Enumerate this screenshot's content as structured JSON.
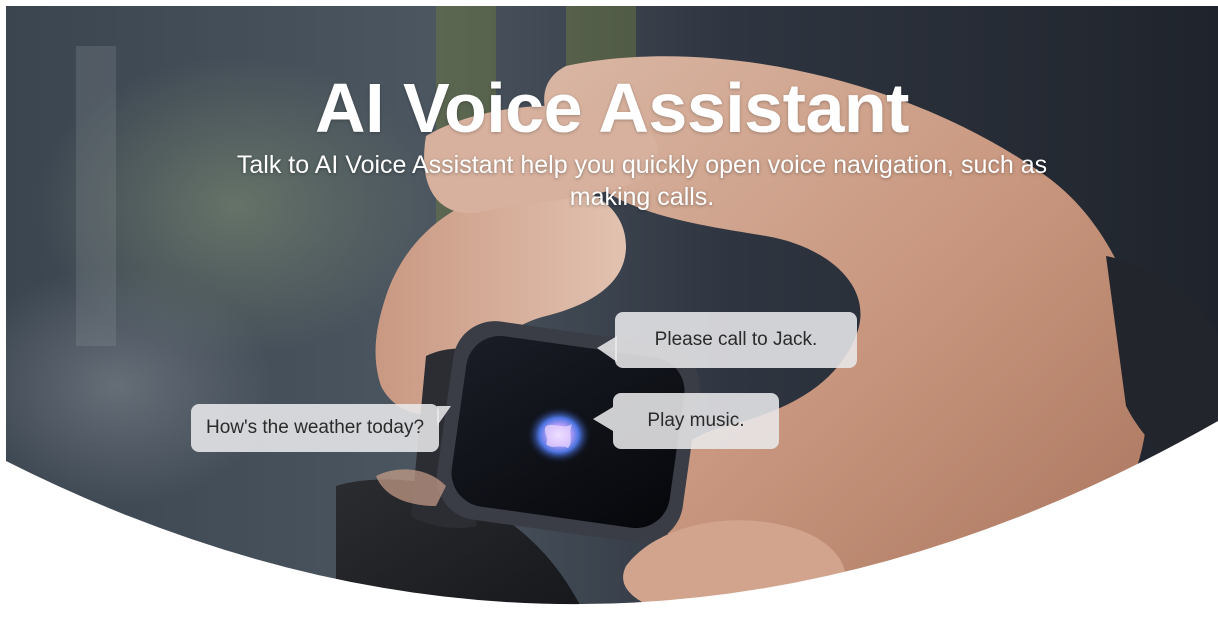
{
  "hero": {
    "title": "AI Voice Assistant",
    "subtitle": "Talk to AI Voice Assistant help you quickly open voice navigation, such as making calls."
  },
  "bubbles": {
    "call": "Please call to Jack.",
    "music": "Play music.",
    "weather": "How's the weather today?"
  },
  "colors": {
    "background": "#ffffff",
    "bubble": "#e8e8ea",
    "text": "#ffffff",
    "bubble_text": "#2b2b2b"
  },
  "icons": {
    "assistant": "voice-assistant-orb-icon"
  }
}
